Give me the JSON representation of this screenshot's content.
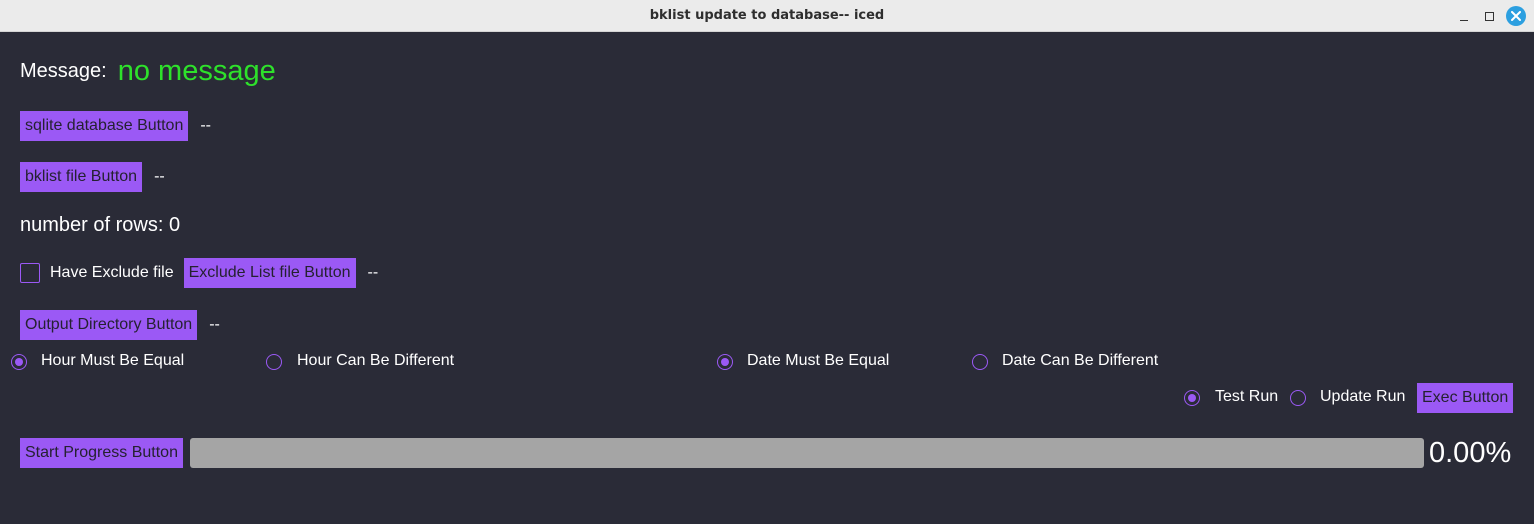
{
  "window": {
    "title": "bklist update to database-- iced"
  },
  "message": {
    "label": "Message:",
    "value": "no message",
    "value_color": "#2ee12b"
  },
  "sqlite": {
    "button_label": "sqlite database Button",
    "path": "--"
  },
  "bklist": {
    "button_label": "bklist file Button",
    "path": "--"
  },
  "rows": {
    "text": "number of rows: 0"
  },
  "exclude": {
    "checkbox_label": "Have Exclude file",
    "checked": false,
    "button_label": "Exclude List file Button",
    "path": "--"
  },
  "output": {
    "button_label": "Output Directory Button",
    "path": "--"
  },
  "hour_options": [
    {
      "label": "Hour Must Be Equal",
      "selected": true
    },
    {
      "label": "Hour Can Be Different",
      "selected": false
    }
  ],
  "date_options": [
    {
      "label": "Date Must Be Equal",
      "selected": true
    },
    {
      "label": "Date Can Be Different",
      "selected": false
    }
  ],
  "run_options": [
    {
      "label": "Test Run",
      "selected": true
    },
    {
      "label": "Update Run",
      "selected": false
    }
  ],
  "exec": {
    "button_label": "Exec Button"
  },
  "progress": {
    "button_label": "Start Progress Button",
    "fraction": 0.0,
    "percent_text": "0.00%"
  },
  "colors": {
    "accent": "#9b59f5",
    "background": "#2a2b37",
    "track": "#a5a5a5"
  }
}
